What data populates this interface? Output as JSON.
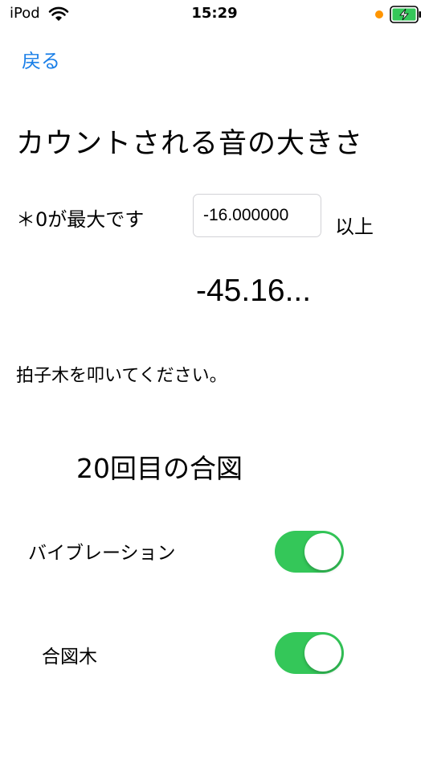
{
  "status_bar": {
    "carrier": "iPod",
    "time": "15:29",
    "icons": [
      "wifi-icon",
      "microphone-in-use-dot",
      "battery-charging-icon"
    ],
    "mic_dot_color": "#ff9500",
    "battery_color": "#34c759"
  },
  "nav": {
    "back_label": "戻る",
    "accent_color": "#1a7fe8"
  },
  "main": {
    "title": "カウントされる音の大きさ",
    "note": "＊0が最大です",
    "threshold_value": "-16.000000",
    "threshold_unit": "以上",
    "current_level": "-45.16...",
    "instruction": "拍子木を叩いてください。",
    "count_label": "20回目の合図"
  },
  "settings": {
    "vibration_label": "バイブレーション",
    "vibration_on": true,
    "clapper_label": "合図木",
    "clapper_on": true,
    "toggle_on_color": "#34c759"
  }
}
